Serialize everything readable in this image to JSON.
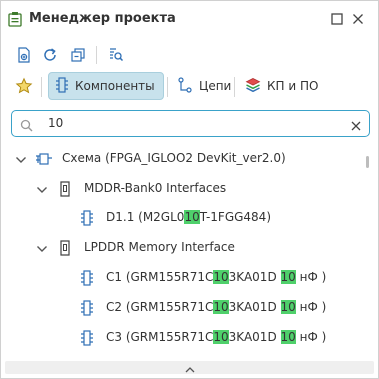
{
  "title": "Менеджер проекта",
  "tabs": [
    {
      "label": "Компоненты",
      "active": true
    },
    {
      "label": "Цепи",
      "active": false
    },
    {
      "label": "КП и ПО",
      "active": false
    }
  ],
  "search": {
    "value": "10"
  },
  "tree": {
    "root": {
      "label": "Схема (FPGA_IGLOO2 DevKit_ver2.0)"
    },
    "groups": [
      {
        "label": "MDDR-Bank0 Interfaces",
        "items": [
          {
            "pre": "D1.1 (M2GL0",
            "hl1": "10",
            "mid": "T-1FGG484)",
            "hl2": "",
            "post": ""
          }
        ]
      },
      {
        "label": "LPDDR Memory Interface",
        "items": [
          {
            "pre": "C1 (GRM155R71C",
            "hl1": "10",
            "mid": "3KA01D ",
            "hl2": "10",
            "post": " нФ  )"
          },
          {
            "pre": "C2 (GRM155R71C",
            "hl1": "10",
            "mid": "3KA01D ",
            "hl2": "10",
            "post": " нФ  )"
          },
          {
            "pre": "C3 (GRM155R71C",
            "hl1": "10",
            "mid": "3KA01D ",
            "hl2": "10",
            "post": " нФ  )"
          }
        ]
      }
    ]
  },
  "colors": {
    "accent": "#3aa2c9",
    "highlight": "#4fd06b",
    "active_tab_bg": "#c8e2ec"
  }
}
